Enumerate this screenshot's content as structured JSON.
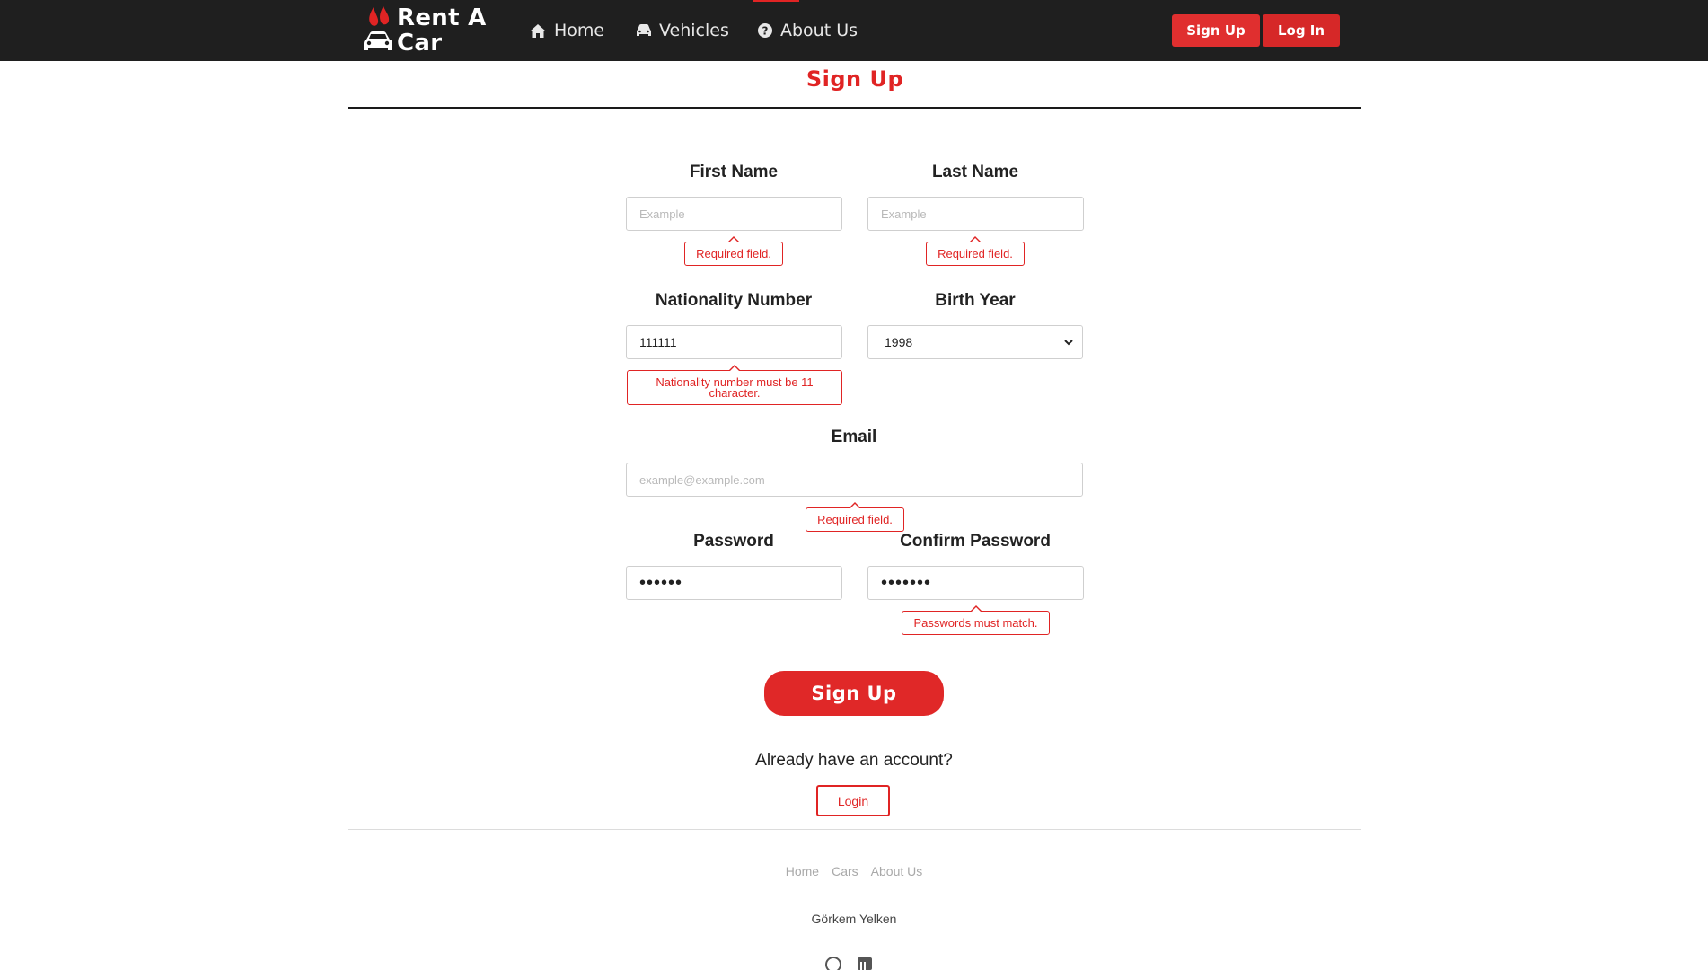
{
  "brand": {
    "line1": "Rent A",
    "line2": "Car"
  },
  "nav": {
    "home_label": "Home",
    "vehicles_label": "Vehicles",
    "about_label": "About Us",
    "signup_label": "Sign Up",
    "login_label": "Log In"
  },
  "page": {
    "title": "Sign Up"
  },
  "form": {
    "first_name": {
      "label": "First Name",
      "placeholder": "Example",
      "error": "Required field."
    },
    "last_name": {
      "label": "Last Name",
      "placeholder": "Example",
      "error": "Required field."
    },
    "nationality_number": {
      "label": "Nationality Number",
      "value": "111111",
      "error": "Nationality number must be 11 character."
    },
    "birth_year": {
      "label": "Birth Year",
      "value": "1998"
    },
    "email": {
      "label": "Email",
      "placeholder": "example@example.com",
      "error": "Required field."
    },
    "password": {
      "label": "Password",
      "value": "••••••"
    },
    "confirm_password": {
      "label": "Confirm Password",
      "value": "•••••••",
      "error": "Passwords must match."
    },
    "submit_label": "Sign Up",
    "already_text": "Already have an account?",
    "login_label": "Login"
  },
  "footer": {
    "links": [
      "Home",
      "Cars",
      "About Us"
    ],
    "author": "Görkem Yelken",
    "icons": [
      "github-icon",
      "linkedin-icon"
    ]
  },
  "colors": {
    "accent": "#e02424",
    "navbar": "#1f1f1f"
  }
}
